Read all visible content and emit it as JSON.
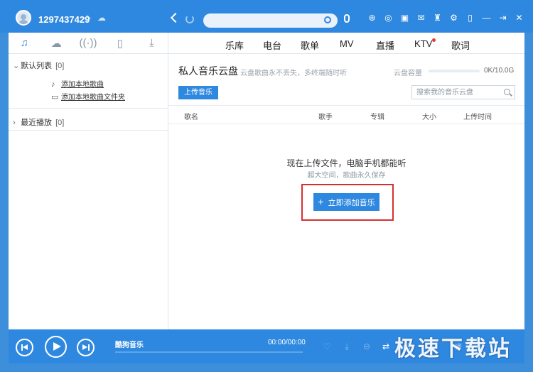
{
  "titlebar": {
    "user_id": "1297437429",
    "search_placeholder": "",
    "icons": [
      "diamond-icon",
      "cloud-icon",
      "mic-icon",
      "skin-icon",
      "game-icon",
      "mail-icon",
      "shirt-icon",
      "settings-icon",
      "minimize-icon",
      "mini-mode-icon",
      "close-icon"
    ]
  },
  "left_tabs": [
    "music-icon",
    "cloud-icon",
    "radio-icon",
    "phone-icon",
    "download-icon"
  ],
  "playlists": {
    "default": {
      "label": "默认列表",
      "count": "[0]"
    },
    "add_song": "添加本地歌曲",
    "add_folder": "添加本地歌曲文件夹",
    "recent": {
      "label": "最近播放",
      "count": "[0]"
    }
  },
  "topnav": [
    "乐库",
    "电台",
    "歌单",
    "MV",
    "直播",
    "KTV",
    "歌词"
  ],
  "cloud": {
    "title": "私人音乐云盘",
    "subtitle": "云盘歌曲永不丢失，多终端随时听",
    "capacity_label": "云盘容量",
    "capacity_value": "0K/10.0G",
    "capacity_fraction": 0,
    "upload_label": "上传音乐",
    "search_placeholder": "搜索我的音乐云盘"
  },
  "columns": [
    "歌名",
    "歌手",
    "专辑",
    "大小",
    "上传时间"
  ],
  "empty": {
    "title": "现在上传文件，电脑手机都能听",
    "subtitle": "超大空间，歌曲永久保存",
    "add_label": "立即添加音乐"
  },
  "player": {
    "song": "酷狗音乐",
    "time": "00:00/00:00",
    "lyric": "词"
  },
  "watermark": "极速下载站",
  "colors": {
    "accent": "#2f88df",
    "highlight": "#d8302f"
  }
}
